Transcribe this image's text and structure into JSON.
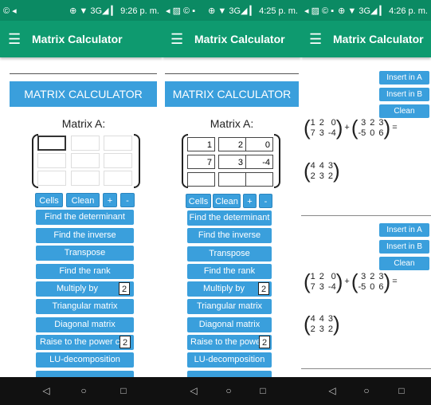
{
  "status": [
    {
      "left_icons": "© ◂",
      "right": "⊕ ▼ 3G◢ ▎ 9:26 p. m."
    },
    {
      "left_icons": "◂ ▨ © ▪",
      "right": "⊕ ▼ 3G◢ ▎ 4:25 p. m."
    },
    {
      "left_icons": "◂ ▨ © ▪",
      "right": "⊕ ▼ 3G◢ ▎ 4:26 p. m."
    }
  ],
  "app": {
    "title": "Matrix Calculator",
    "menu_icon": "hamburger-menu-icon"
  },
  "calc": {
    "banner": "MATRIX CALCULATOR",
    "matrix_label": "Matrix A:",
    "cells_button": "Cells",
    "clean_button": "Clean",
    "plus_button": "+",
    "minus_button": "-",
    "operations": [
      "Find the determinant",
      "Find the inverse",
      "Transpose",
      "Find the rank",
      "Multiply by",
      "Triangular matrix",
      "Diagonal matrix",
      "Raise to the power c",
      "LU-decomposition"
    ],
    "multiply_value": "2",
    "power_value": "2"
  },
  "matrix_a_filled": [
    [
      "1",
      "2",
      "0"
    ],
    [
      "7",
      "3",
      "-4"
    ],
    [
      "",
      "",
      ""
    ]
  ],
  "results": {
    "insert_a": "Insert in A",
    "insert_b": "Insert in B",
    "clean": "Clean",
    "plus_sign": "+",
    "equals_sign": "=",
    "operand_a": [
      [
        "1",
        "2",
        "0"
      ],
      [
        "7",
        "3",
        "-4"
      ]
    ],
    "operand_b": [
      [
        "3",
        "2",
        "3"
      ],
      [
        "-5",
        "0",
        "6"
      ]
    ],
    "result": [
      [
        "4",
        "4",
        "3"
      ],
      [
        "2",
        "3",
        "2"
      ]
    ]
  },
  "nav": {
    "back": "◁",
    "home": "○",
    "recent": "□"
  }
}
